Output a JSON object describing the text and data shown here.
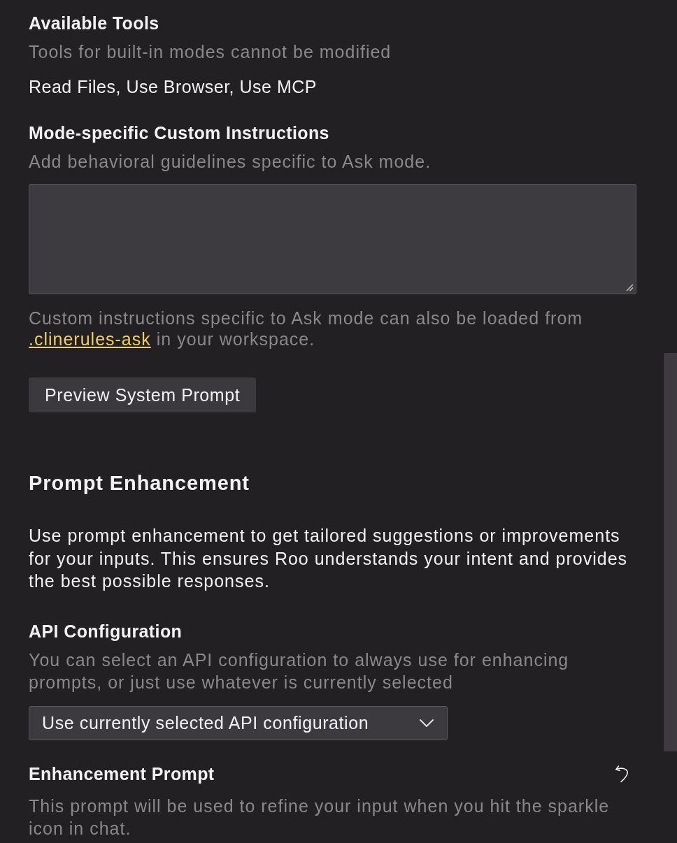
{
  "available_tools": {
    "title": "Available Tools",
    "description": "Tools for built-in modes cannot be modified",
    "value": "Read Files, Use Browser, Use MCP"
  },
  "custom_instructions": {
    "title": "Mode-specific Custom Instructions",
    "description": "Add behavioral guidelines specific to Ask mode.",
    "note_before": "Custom instructions specific to Ask mode can also be loaded from ",
    "note_link": ".clinerules-ask",
    "note_after": " in your workspace."
  },
  "preview_button": {
    "label": "Preview System Prompt"
  },
  "prompt_enhancement": {
    "title": "Prompt Enhancement",
    "description": "Use prompt enhancement to get tailored suggestions or improvements for your inputs. This ensures Roo understands your intent and provides the best possible responses."
  },
  "api_configuration": {
    "title": "API Configuration",
    "description": "You can select an API configuration to always use for enhancing prompts, or just use whatever is currently selected",
    "select": {
      "value": "Use currently selected API configuration"
    }
  },
  "enhancement_prompt": {
    "title": "Enhancement Prompt",
    "description": "This prompt will be used to refine your input when you hit the sparkle icon in chat."
  }
}
